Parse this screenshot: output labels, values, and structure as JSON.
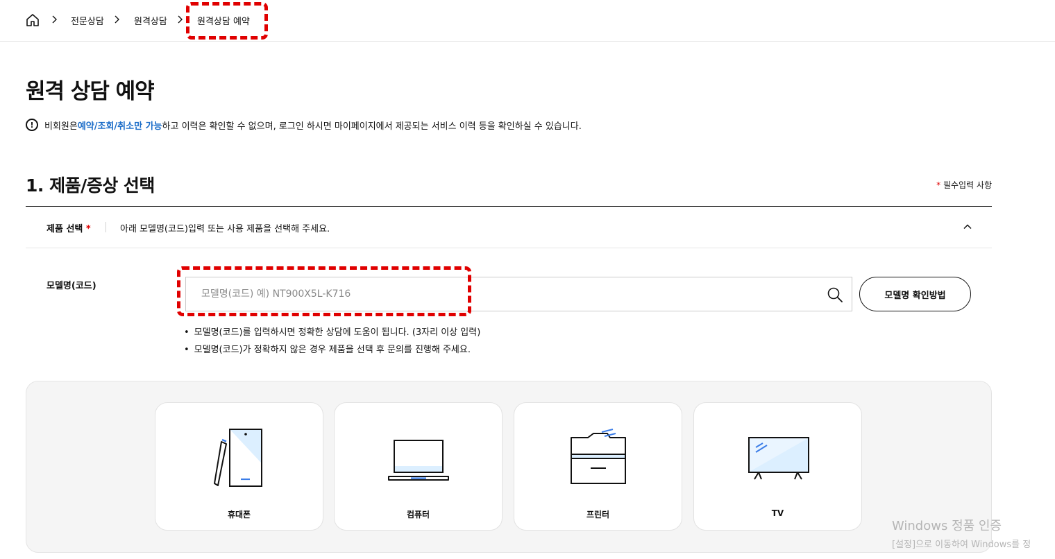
{
  "breadcrumb": {
    "items": [
      "전문상담",
      "원격상담",
      "원격상담 예약"
    ]
  },
  "page": {
    "title": "원격 상담 예약"
  },
  "notice": {
    "icon_text": "!",
    "before": "비회원은 ",
    "highlight": "예약/조회/취소만 가능",
    "after": "하고 이력은 확인할 수 없으며, 로그인 하시면 마이페이지에서 제공되는 서비스 이력 등을 확인하실 수 있습니다."
  },
  "section": {
    "title": "1. 제품/증상 선택",
    "required_star": "*",
    "required_note": " 필수입력 사항"
  },
  "product_select": {
    "label": "제품 선택",
    "star": " *",
    "description": "아래 모델명(코드)입력 또는 사용 제품을 선택해 주세요."
  },
  "model": {
    "label": "모델명(코드)",
    "placeholder": "모델명(코드) 예) NT900X5L-K716",
    "value": "",
    "howto_button": "모델명 확인방법",
    "hints": [
      "모델명(코드)를 입력하시면 정확한 상담에 도움이 됩니다. (3자리 이상 입력)",
      "모델명(코드)가 정확하지 않은 경우 제품을 선택 후 문의를 진행해 주세요."
    ]
  },
  "products": [
    {
      "label": "휴대폰",
      "icon": "phone-icon"
    },
    {
      "label": "컴퓨터",
      "icon": "laptop-icon"
    },
    {
      "label": "프린터",
      "icon": "printer-icon"
    },
    {
      "label": "TV",
      "icon": "tv-icon"
    }
  ],
  "watermark": {
    "line1": "Windows 정품 인증",
    "line2": "[설정]으로 이동하여 Windows를 정"
  },
  "colors": {
    "accent_blue": "#1a6cc8",
    "required_red": "#e00000",
    "annotation_red": "#e00000"
  }
}
